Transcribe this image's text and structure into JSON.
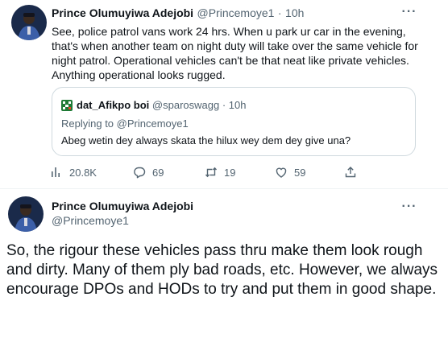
{
  "tweet1": {
    "author_name": "Prince Olumuyiwa Adejobi",
    "author_handle": "@Princemoye1",
    "separator": "·",
    "time": "10h",
    "body": "See, police patrol vans work 24 hrs. When u park ur car in the evening, that's when another team on night duty will take over the same vehicle for night patrol. Operational vehicles can't be that neat like private vehicles. Anything operational looks rugged.",
    "more_label": "···",
    "quote": {
      "author_name": "dat_Afikpo boi",
      "author_handle": "@sparoswagg",
      "separator": "·",
      "time": "10h",
      "replying_to": "Replying to @Princemoye1",
      "text": "Abeg wetin dey always skata the hilux wey dem dey give una?"
    },
    "actions": {
      "views": "20.8K",
      "replies": "69",
      "retweets": "19",
      "likes": "59"
    }
  },
  "tweet2": {
    "author_name": "Prince Olumuyiwa Adejobi",
    "author_handle": "@Princemoye1",
    "more_label": "···",
    "body": "So, the rigour these vehicles pass thru make them look rough and dirty. Many of them ply bad roads, etc. However, we always encourage DPOs and HODs to try and put them in good shape."
  },
  "colors": {
    "text_primary": "#0f1419",
    "text_secondary": "#536471",
    "border": "#cfd9de",
    "avatar_background": "#1a2a4a",
    "avatar_uniform": "#3c5fa8"
  }
}
